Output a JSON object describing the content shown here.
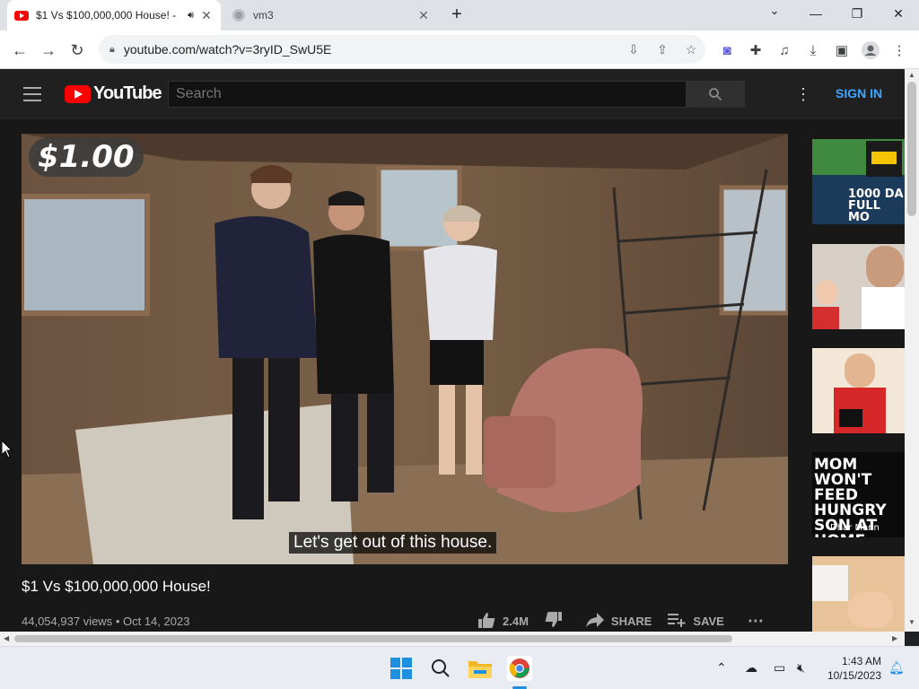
{
  "browser": {
    "tabs": [
      {
        "title": "$1 Vs $100,000,000 House! -",
        "active": true,
        "icon": "youtube-icon",
        "audio_icon": "speaker-icon"
      },
      {
        "title": "vm3",
        "active": false,
        "icon": "globe-icon"
      }
    ],
    "url": "youtube.com/watch?v=3ryID_SwU5E"
  },
  "youtube": {
    "search_placeholder": "Search",
    "sign_in": "SIGN IN",
    "logo_text": "YouTube",
    "video": {
      "overlay_price": "$1.00",
      "caption": "Let's get out of this house.",
      "title": "$1 Vs $100,000,000 House!",
      "views": "44,054,937 views",
      "date": "Oct 14, 2023",
      "likes": "2.4M",
      "share": "SHARE",
      "save": "SAVE"
    },
    "recommendations": [
      {
        "overlay": "1000 DA FULL MO",
        "bg": "#1c3b5a"
      },
      {
        "overlay": "",
        "bg": "#d8d0c6"
      },
      {
        "overlay": "",
        "bg": "#f3e7d8"
      },
      {
        "overlay": "MOM WON'T FEED HUNGRY SON AT HOME",
        "sub": "Dhar Mann",
        "bg": "#0b0b0b"
      },
      {
        "overlay": "",
        "bg": "#e8c39a"
      }
    ]
  },
  "taskbar": {
    "time": "1:43 AM",
    "date": "10/15/2023"
  },
  "colors": {
    "yt_red": "#ff0000",
    "yt_blue": "#3ea6ff",
    "yt_bg": "#181818"
  }
}
